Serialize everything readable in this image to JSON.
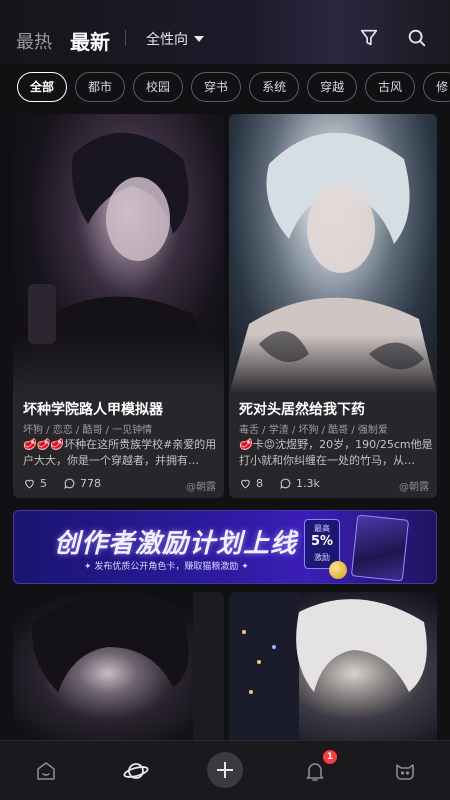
{
  "header": {
    "tab_hot": "最热",
    "tab_new": "最新",
    "preference": "全性向"
  },
  "chips": [
    "全部",
    "都市",
    "校园",
    "穿书",
    "系统",
    "穿越",
    "古风",
    "修"
  ],
  "cards": [
    {
      "title": "坏种学院路人甲模拟器",
      "tags": "坏狗 / 恋恋 / 酷哥 / 一见钟情",
      "desc": "🥩🥩🥩坏种在这所贵族学校#亲爱的用户大大，你是一个穿越者，并拥有…",
      "likes": "5",
      "comments": "778",
      "author": "@朝露"
    },
    {
      "title": "死对头居然给我下药",
      "tags": "毒舌 / 学渣 / 坏狗 / 酷哥 / 强制爱",
      "desc": "🥩卡😡沈煜野，20岁，190/25cm他是打小就和你纠缠在一处的竹马，从…",
      "likes": "8",
      "comments": "1.3k",
      "author": "@朝露"
    }
  ],
  "banner": {
    "title": "创作者激励计划上线",
    "subtitle": "✦ 发布优质公开角色卡，赚取猫粮激励 ✦",
    "badge_small": "最高",
    "badge_big": "5%",
    "badge_label": "激励"
  },
  "nav": {
    "notification_count": "1"
  }
}
